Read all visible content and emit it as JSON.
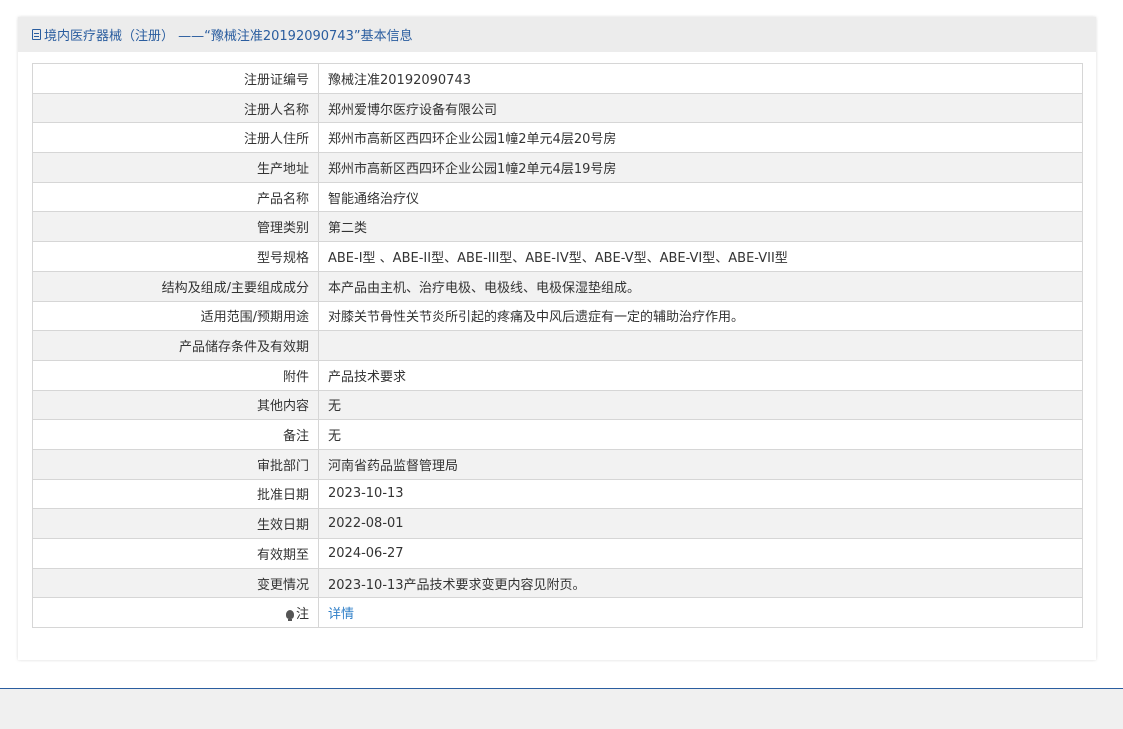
{
  "header": {
    "title": "境内医疗器械（注册）  ——“豫械注准20192090743”基本信息"
  },
  "rows": [
    {
      "label": "注册证编号",
      "value": "豫械注准20192090743"
    },
    {
      "label": "注册人名称",
      "value": "郑州爱博尔医疗设备有限公司"
    },
    {
      "label": "注册人住所",
      "value": "郑州市高新区西四环企业公园1幢2单元4层20号房"
    },
    {
      "label": "生产地址",
      "value": "郑州市高新区西四环企业公园1幢2单元4层19号房"
    },
    {
      "label": "产品名称",
      "value": "智能通络治疗仪"
    },
    {
      "label": "管理类别",
      "value": "第二类"
    },
    {
      "label": "型号规格",
      "value": "ABE-I型 、ABE-II型、ABE-III型、ABE-IV型、ABE-V型、ABE-VI型、ABE-VII型"
    },
    {
      "label": "结构及组成/主要组成成分",
      "value": "本产品由主机、治疗电极、电极线、电极保湿垫组成。"
    },
    {
      "label": "适用范围/预期用途",
      "value": "对膝关节骨性关节炎所引起的疼痛及中风后遗症有一定的辅助治疗作用。"
    },
    {
      "label": "产品储存条件及有效期",
      "value": ""
    },
    {
      "label": "附件",
      "value": "产品技术要求"
    },
    {
      "label": "其他内容",
      "value": "无"
    },
    {
      "label": "备注",
      "value": "无"
    },
    {
      "label": "审批部门",
      "value": "河南省药品监督管理局"
    },
    {
      "label": "批准日期",
      "value": "2023-10-13"
    },
    {
      "label": "生效日期",
      "value": "2022-08-01"
    },
    {
      "label": "有效期至",
      "value": "2024-06-27"
    },
    {
      "label": "变更情况",
      "value": "2023-10-13产品技术要求变更内容见附页。"
    }
  ],
  "note_row": {
    "label": "注",
    "icon": "lightbulb-icon",
    "link_text": "详情"
  }
}
